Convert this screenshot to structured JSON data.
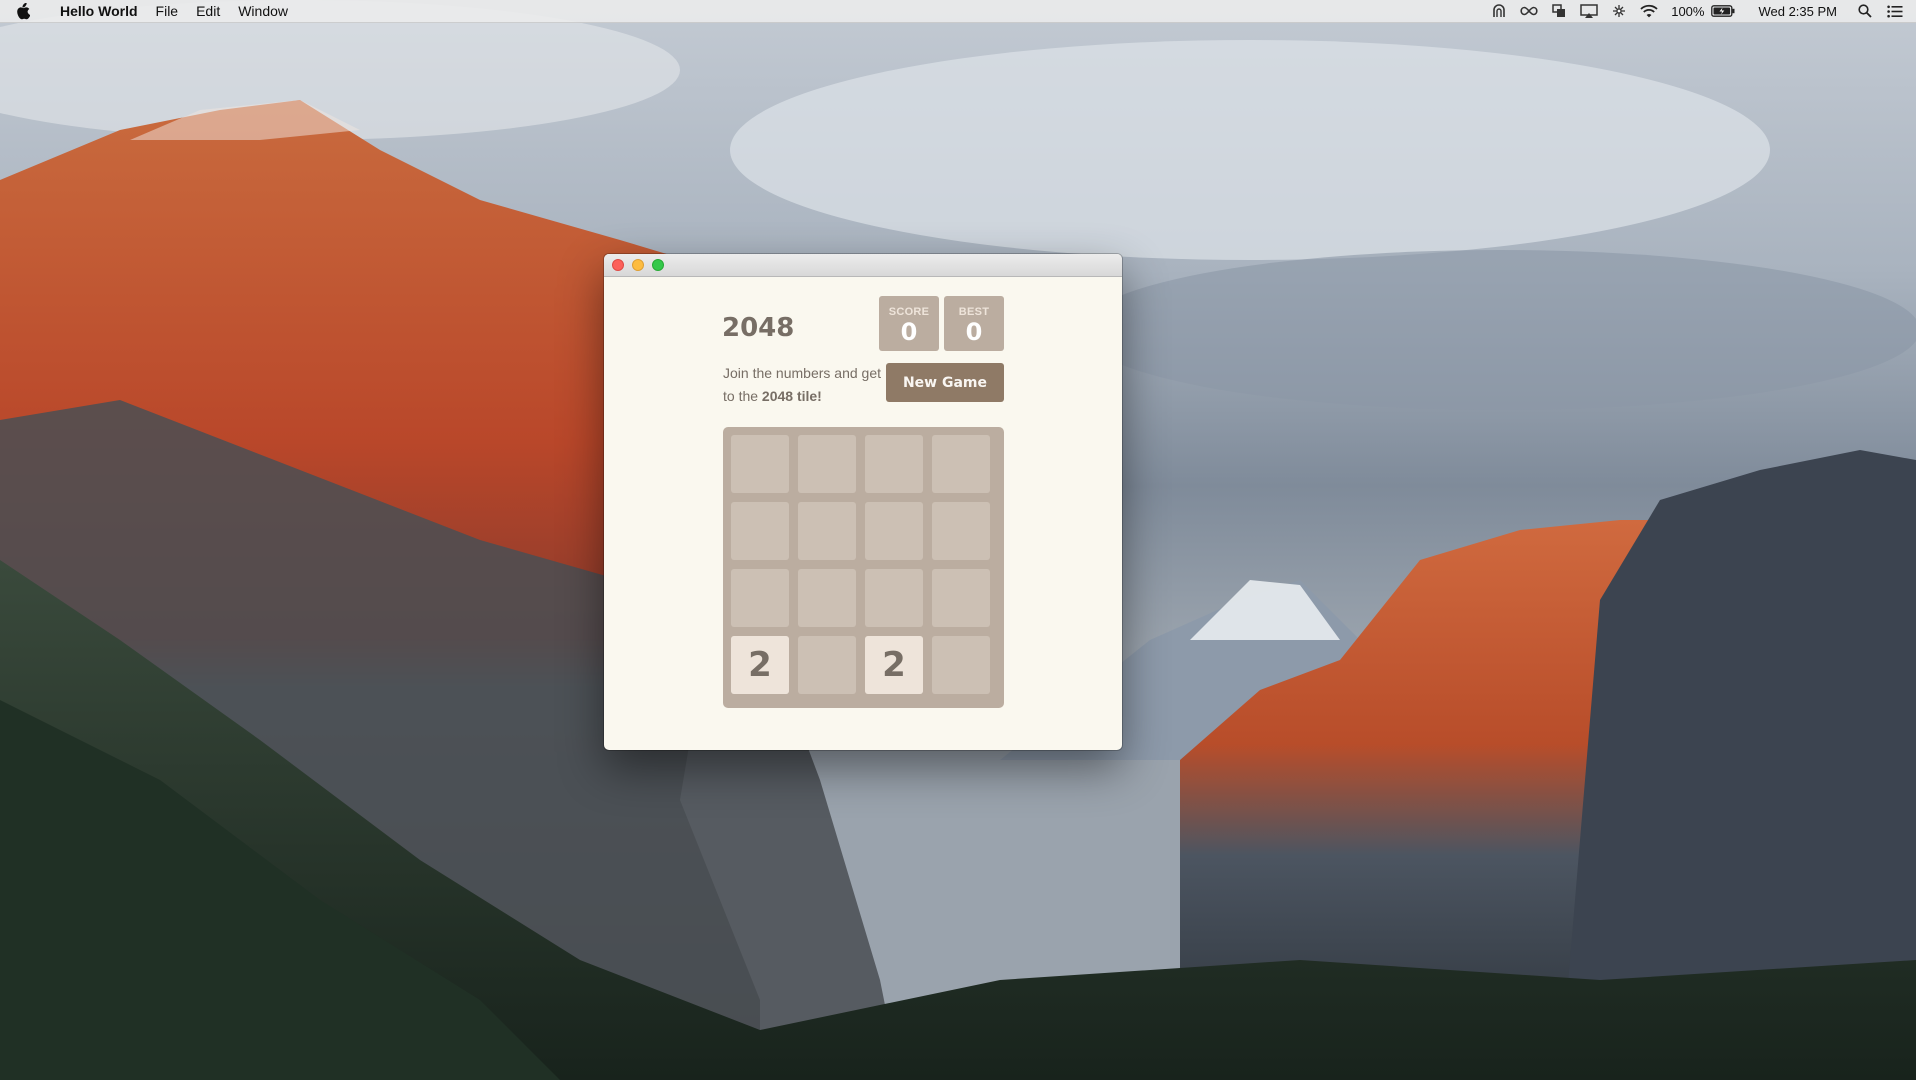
{
  "menubar": {
    "app_name": "Hello World",
    "menus": [
      "File",
      "Edit",
      "Window"
    ],
    "status_icons": [
      "alfred-icon",
      "infinity-icon",
      "screens-icon",
      "airplay-icon",
      "magnet-icon",
      "wifi-icon"
    ],
    "battery_percent": "100%",
    "clock": "Wed 2:35 PM"
  },
  "window": {
    "traffic_lights": [
      "close",
      "minimize",
      "zoom"
    ]
  },
  "game": {
    "title": "2048",
    "score_label": "SCORE",
    "score_value": "0",
    "best_label": "BEST",
    "best_value": "0",
    "intro_prefix": "Join the numbers and get to the ",
    "intro_bold": "2048 tile!",
    "new_game_label": "New Game",
    "grid": [
      [
        null,
        null,
        null,
        null
      ],
      [
        null,
        null,
        null,
        null
      ],
      [
        null,
        null,
        null,
        null
      ],
      [
        2,
        null,
        2,
        null
      ]
    ]
  },
  "colors": {
    "window_bg": "#faf8ef",
    "board_bg": "#bbada0",
    "tile_2_bg": "#eee4da",
    "text_dark": "#776e65",
    "button_bg": "#8f7a66"
  }
}
